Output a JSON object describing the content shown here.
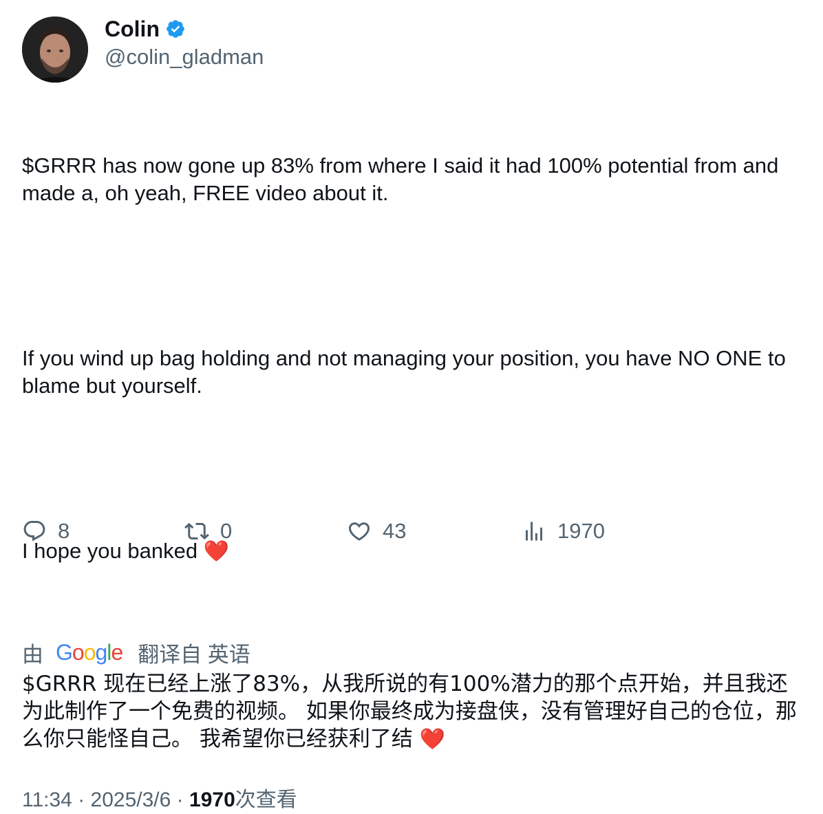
{
  "author": {
    "display_name": "Colin",
    "handle": "@colin_gladman",
    "verified": true,
    "verified_color": "#1d9bf0"
  },
  "tweet": {
    "paragraphs": [
      "$GRRR has now gone up 83% from where I said it had 100% potential from and made a, oh yeah, FREE video about it.",
      "If you wind up bag holding and not managing your position, you have NO ONE to blame but yourself.",
      "I hope you banked"
    ],
    "heart_emoji": "❤️"
  },
  "translation": {
    "prefix": "由",
    "provider": "Google",
    "suffix": "翻译自 英语",
    "text": "$GRRR 现在已经上涨了83%，从我所说的有100%潜力的那个点开始，并且我还为此制作了一个免费的视频。 如果你最终成为接盘侠，没有管理好自己的仓位，那么你只能怪自己。 我希望你已经获利了结",
    "heart_emoji": "❤️"
  },
  "meta": {
    "time": "11:34",
    "date": "2025/3/6",
    "views_count": "1970",
    "views_label": "次查看",
    "separator": "·"
  },
  "actions": {
    "replies": "8",
    "retweets": "0",
    "likes": "43",
    "views": "1970"
  },
  "colors": {
    "text_primary": "#0f1419",
    "text_secondary": "#536471",
    "heart": "#e0245e",
    "google_blue": "#4285F4",
    "google_red": "#EA4335",
    "google_yellow": "#FBBC05",
    "google_green": "#34A853"
  }
}
